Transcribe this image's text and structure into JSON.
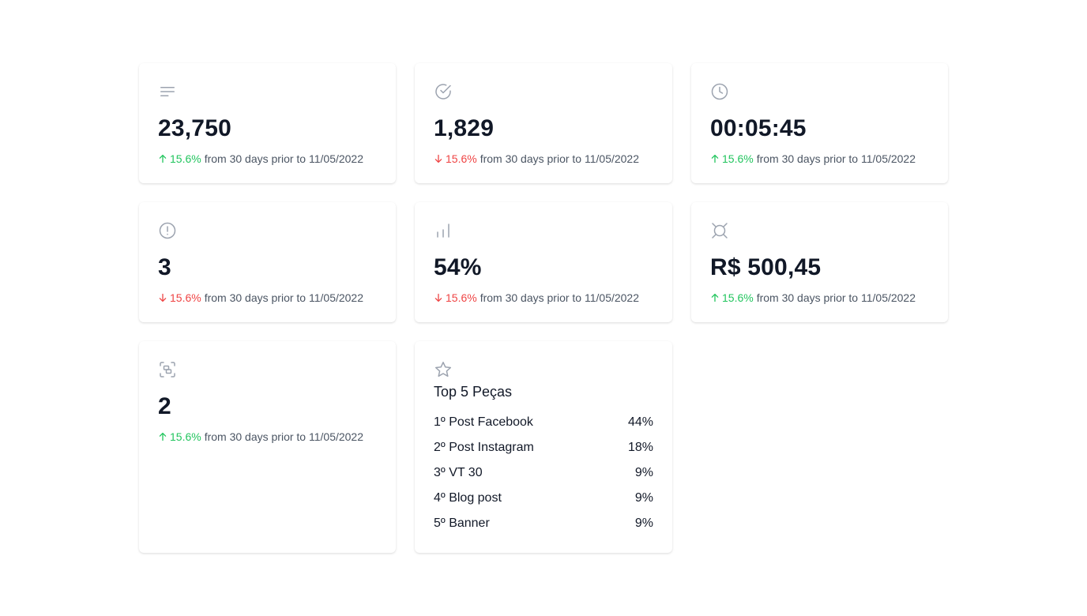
{
  "stats": [
    {
      "icon": "menu-lines-icon",
      "value": "23,750",
      "direction": "up",
      "change": "15.6%",
      "caption": "from 30 days prior to 11/05/2022"
    },
    {
      "icon": "check-circle-icon",
      "value": "1,829",
      "direction": "down",
      "change": "15.6%",
      "caption": "from 30 days prior to 11/05/2022"
    },
    {
      "icon": "clock-icon",
      "value": "00:05:45",
      "direction": "up",
      "change": "15.6%",
      "caption": "from 30 days prior to 11/05/2022"
    },
    {
      "icon": "alert-circle-icon",
      "value": "3",
      "direction": "down",
      "change": "15.6%",
      "caption": "from 30 days prior to 11/05/2022"
    },
    {
      "icon": "bar-chart-icon",
      "value": "54%",
      "direction": "down",
      "change": "15.6%",
      "caption": "from 30 days prior to 11/05/2022"
    },
    {
      "icon": "currency-icon",
      "value": "R$ 500,45",
      "direction": "up",
      "change": "15.6%",
      "caption": "from 30 days prior to 11/05/2022"
    },
    {
      "icon": "scan-icon",
      "value": "2",
      "direction": "up",
      "change": "15.6%",
      "caption": "from 30 days prior to 11/05/2022"
    }
  ],
  "top": {
    "icon": "star-icon",
    "title": "Top 5 Peças",
    "items": [
      {
        "label": "1º Post Facebook",
        "pct": "44%"
      },
      {
        "label": "2º Post Instagram",
        "pct": "18%"
      },
      {
        "label": "3º VT 30",
        "pct": "9%"
      },
      {
        "label": "4º Blog post",
        "pct": "9%"
      },
      {
        "label": "5º Banner",
        "pct": "9%"
      }
    ]
  },
  "colors": {
    "up": "#22c55e",
    "down": "#ef4444",
    "icon": "#9ca3af"
  }
}
